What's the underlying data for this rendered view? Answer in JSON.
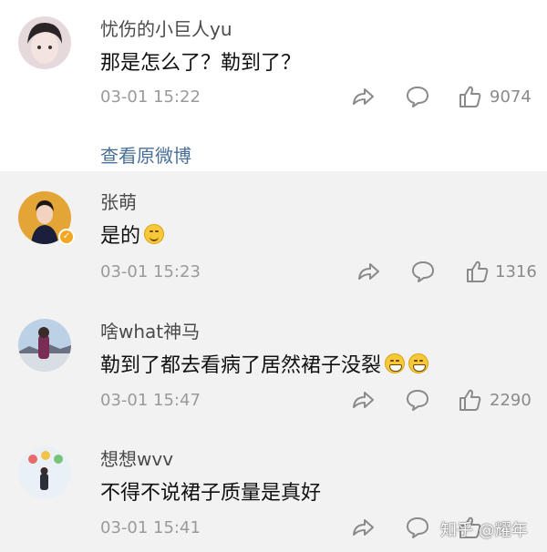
{
  "comments": [
    {
      "username": "忧伤的小巨人yu",
      "text": "那是怎么了？勒到了？",
      "time": "03-01 15:22",
      "likes": "9074",
      "icons": [
        "share-icon",
        "comment-icon",
        "like-icon"
      ]
    },
    {
      "username": "张萌",
      "text": "是的",
      "time": "03-01 15:23",
      "likes": "1316",
      "verified": true,
      "emoji": "smirk-emoji"
    },
    {
      "username": "啥what神马",
      "text": "勒到了都去看病了居然裙子没裂",
      "time": "03-01 15:47",
      "likes": "2290",
      "emoji": "grin-emoji"
    },
    {
      "username": "想想wvv",
      "text": "不得不说裙子质量是真好",
      "time": "03-01 15:41",
      "likes": ""
    }
  ],
  "view_original": "查看原微博",
  "watermark": "知乎 @耀年",
  "colors": {
    "reply_background": "#f2f2f2",
    "link": "#4a6f96",
    "meta_text": "#9a9a9a"
  }
}
